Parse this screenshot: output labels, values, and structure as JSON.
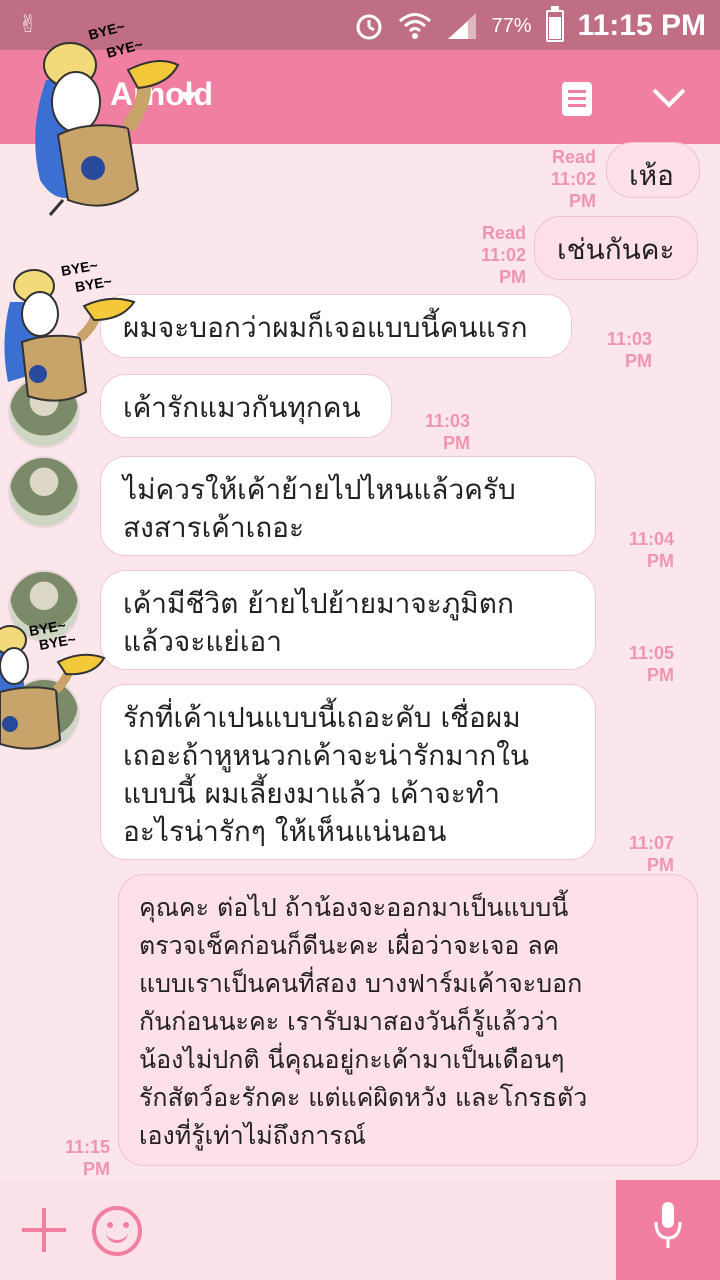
{
  "status_bar": {
    "battery_percent": "77%",
    "battery_level": 0.77,
    "time": "11:15 PM"
  },
  "header": {
    "contact_name": "Arnold"
  },
  "stickers": {
    "bye_text_1": "BYE~",
    "bye_text_2": "BYE~"
  },
  "messages": [
    {
      "id": "m1",
      "side": "out",
      "text": "เห้อ",
      "status": "Read",
      "time": "11:02 PM"
    },
    {
      "id": "m2",
      "side": "out",
      "text": "เช่นกันคะ",
      "status": "Read",
      "time": "11:02 PM"
    },
    {
      "id": "m3",
      "side": "in",
      "text": "ผมจะบอกว่าผมก็เจอแบบนี้คนแรก",
      "time": "11:03 PM"
    },
    {
      "id": "m4",
      "side": "in",
      "text": "เค้ารักแมวกันทุกคน",
      "time": "11:03 PM"
    },
    {
      "id": "m5",
      "side": "in",
      "lines": [
        "ไม่ควรให้เค้าย้ายไปไหนแล้วครับ",
        "สงสารเค้าเถอะ"
      ],
      "time": "11:04 PM"
    },
    {
      "id": "m6",
      "side": "in",
      "lines": [
        "เค้ามีชีวิต ย้ายไปย้ายมาจะภูมิตก",
        "แล้วจะแย่เอา"
      ],
      "time": "11:05 PM"
    },
    {
      "id": "m7",
      "side": "in",
      "lines": [
        "รักที่เค้าเปนแบบนี้เถอะคับ เชื่อผม",
        "เถอะถ้าหูหนวกเค้าจะน่ารักมากใน",
        "แบบนี้ ผมเลี้ยงมาแล้ว เค้าจะทำ",
        "อะไรน่ารักๆ ให้เห็นแน่นอน"
      ],
      "time": "11:07 PM"
    },
    {
      "id": "m8",
      "side": "out",
      "lines": [
        "คุณคะ ต่อไป ถ้าน้องจะออกมาเป็นแบบนี้",
        "ตรวจเช็คก่อนก็ดีนะคะ เผื่อว่าจะเจอ ลค",
        "แบบเราเป็นคนที่สอง บางฟาร์มเค้าจะบอก",
        "กันก่อนนะคะ เรารับมาสองวันก็รู้แล้วว่า",
        "น้องไม่ปกติ นี่คุณอยู่กะเค้ามาเป็นเดือนๆ",
        "รักสัตว์อะรักคะ แต่แค่ผิดหวัง และโกรธตัว",
        "เองที่รู้เท่าไม่ถึงการณ์"
      ],
      "time": "11:15 PM"
    }
  ]
}
